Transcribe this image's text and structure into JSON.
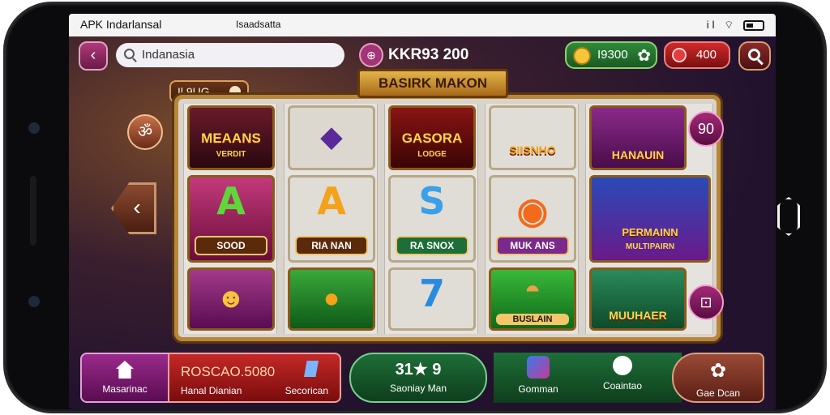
{
  "statusbar": {
    "app_name": "APK Indarlansal",
    "subtitle": "Isaadsatta",
    "signal_icons": "il ⌔"
  },
  "topbar": {
    "back_glyph": "‹",
    "search_value": "Indanasia",
    "bag_glyph": "⊕",
    "balance": "KKR93 200",
    "coins": "I9300",
    "gems": "400",
    "gear_glyph": "✿"
  },
  "tag": {
    "label": "Il 9UG"
  },
  "banner": {
    "title": "BASIRK MAKON"
  },
  "left_chip": {
    "glyph": "ॐ"
  },
  "left_arrow": {
    "glyph": "‹"
  },
  "right_chip_top": {
    "label": "90"
  },
  "right_chip_bottom": {
    "glyph": "⊡"
  },
  "reels": [
    {
      "tiles": [
        {
          "kind": "title",
          "text": "MEAANS",
          "sub": "VERDIT"
        },
        {
          "kind": "letter",
          "text": "A",
          "caption": "SOOD"
        },
        {
          "kind": "glyph",
          "text": "☻"
        }
      ]
    },
    {
      "tiles": [
        {
          "kind": "glyph",
          "text": "◆"
        },
        {
          "kind": "letter",
          "text": "A",
          "caption": "RIA NAN"
        },
        {
          "kind": "glyph",
          "text": "●"
        }
      ]
    },
    {
      "tiles": [
        {
          "kind": "title",
          "text": "GASORA",
          "sub": "LODGE"
        },
        {
          "kind": "letter",
          "text": "S",
          "caption": "RA SNOX"
        },
        {
          "kind": "letter",
          "text": "7",
          "caption": ""
        }
      ]
    },
    {
      "tiles": [
        {
          "kind": "title",
          "text": "SIISNHO",
          "sub": ""
        },
        {
          "kind": "glyph",
          "text": "◉",
          "caption": "MUK ANS"
        },
        {
          "kind": "glyph",
          "text": "◓",
          "caption": "BUSLAIN"
        }
      ]
    },
    {
      "tiles": [
        {
          "kind": "title",
          "text": "HANAUIN",
          "sub": ""
        },
        {
          "kind": "title",
          "text": "PERMAINN",
          "sub": "MULTIPAIRN"
        },
        {
          "kind": "title",
          "text": "MUUHAER",
          "sub": ""
        }
      ]
    }
  ],
  "bottom": {
    "home_label": "Masarinac",
    "amount": "ROSCAO.5080",
    "amount_sub": "Hanal Dianian",
    "secondary_label": "Secorican",
    "score": "31★ 9",
    "score_label": "Saoniay Man",
    "item1_label": "Gomman",
    "item2_label": "Coaintao",
    "last_label": "Gae Dcan"
  },
  "colors": {
    "accent_purple": "#a43478",
    "accent_green": "#2e8a3a",
    "accent_red": "#c42828",
    "board_gold": "#b8863a"
  }
}
